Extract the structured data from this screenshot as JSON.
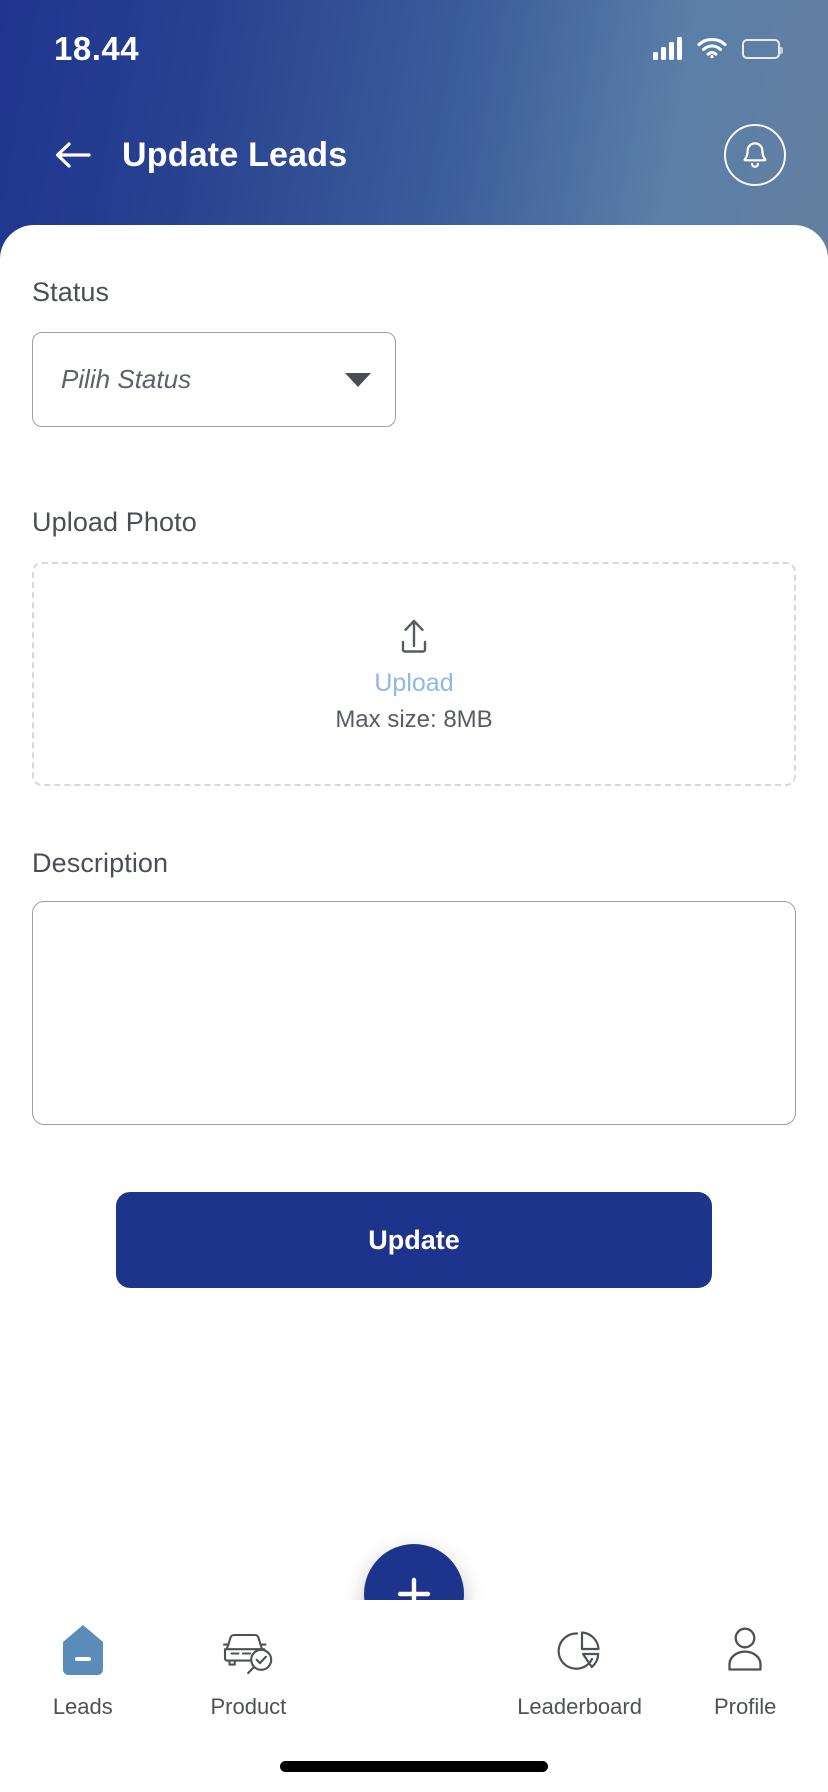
{
  "status_bar": {
    "time": "18.44",
    "signal_icon": "signal-bars-icon",
    "wifi_icon": "wifi-icon",
    "battery_icon": "battery-icon"
  },
  "header": {
    "title": "Update Leads",
    "back_icon": "arrow-left-icon",
    "notification_icon": "bell-icon",
    "gradient_start": "#1f3590",
    "gradient_end": "#637f9f"
  },
  "form": {
    "status": {
      "label": "Status",
      "placeholder": "Pilih Status",
      "value": "Pilih Status",
      "caret_icon": "chevron-down-icon"
    },
    "upload": {
      "label": "Upload Photo",
      "icon": "upload-arrow-icon",
      "link_text": "Upload",
      "hint": "Max size: 8MB",
      "link_color": "#8fb8e8"
    },
    "description": {
      "label": "Description",
      "value": "",
      "placeholder": ""
    },
    "submit": {
      "label": "Update",
      "color": "#1c348c"
    }
  },
  "bottom_nav": {
    "fab": {
      "icon": "plus-icon",
      "color": "#1c348c"
    },
    "items": [
      {
        "label": "Leads",
        "icon": "tag-pin-icon",
        "active": true,
        "color": "#5b8bb8"
      },
      {
        "label": "Product",
        "icon": "car-check-icon",
        "active": false,
        "color": "#4e5156"
      },
      {
        "label": "Leaderboard",
        "icon": "pie-chart-icon",
        "active": false,
        "color": "#4e5156"
      },
      {
        "label": "Profile",
        "icon": "person-icon",
        "active": false,
        "color": "#4e5156"
      }
    ]
  }
}
